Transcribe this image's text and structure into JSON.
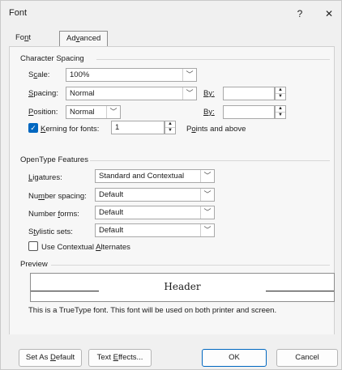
{
  "window": {
    "title": "Font",
    "help_icon": "?",
    "close_icon": "✕"
  },
  "tabs": [
    {
      "label": "Font",
      "accel": "n",
      "active": false
    },
    {
      "label": "Advanced",
      "accel": "v",
      "active": true
    }
  ],
  "character_spacing": {
    "heading": "Character Spacing",
    "scale": {
      "label_pre": "S",
      "label_accel": "c",
      "label_post": "ale:",
      "value": "100%"
    },
    "spacing": {
      "label_accel": "S",
      "label_post": "pacing:",
      "value": "Normal",
      "by_accel": "B",
      "by_post": "y:",
      "by_value": ""
    },
    "position": {
      "label_accel": "P",
      "label_post": "osition:",
      "value": "Normal",
      "by_accel": "B",
      "by_post": "y:",
      "by_value": ""
    },
    "kerning": {
      "checked": true,
      "label_accel": "K",
      "label_post": "erning for fonts:",
      "value": "1",
      "suffix_pre": "P",
      "suffix_accel": "o",
      "suffix_post": "ints and above"
    }
  },
  "opentype": {
    "heading": "OpenType Features",
    "ligatures": {
      "label_accel": "L",
      "label_post": "igatures:",
      "value": "Standard and Contextual"
    },
    "number_spacing": {
      "label_pre": "Nu",
      "label_accel": "m",
      "label_post": "ber spacing:",
      "value": "Default"
    },
    "number_forms": {
      "label_pre": "Number ",
      "label_accel": "f",
      "label_post": "orms:",
      "value": "Default"
    },
    "stylistic_sets": {
      "label_pre": "S",
      "label_accel": "t",
      "label_post": "ylistic sets:",
      "value": "Default"
    },
    "contextual_alternates": {
      "checked": false,
      "label_pre": "Use Contextual ",
      "label_accel": "A",
      "label_post": "lternates"
    }
  },
  "preview": {
    "heading": "Preview",
    "sample": "Header",
    "note": "This is a TrueType font. This font will be used on both printer and screen."
  },
  "buttons": {
    "set_default": {
      "pre": "Set As ",
      "accel": "D",
      "post": "efault"
    },
    "text_effects": {
      "pre": "Text ",
      "accel": "E",
      "post": "ffects..."
    },
    "ok": "OK",
    "cancel": "Cancel"
  },
  "colors": {
    "accent": "#0067c0",
    "dialog_bg": "#f0f0f0"
  }
}
